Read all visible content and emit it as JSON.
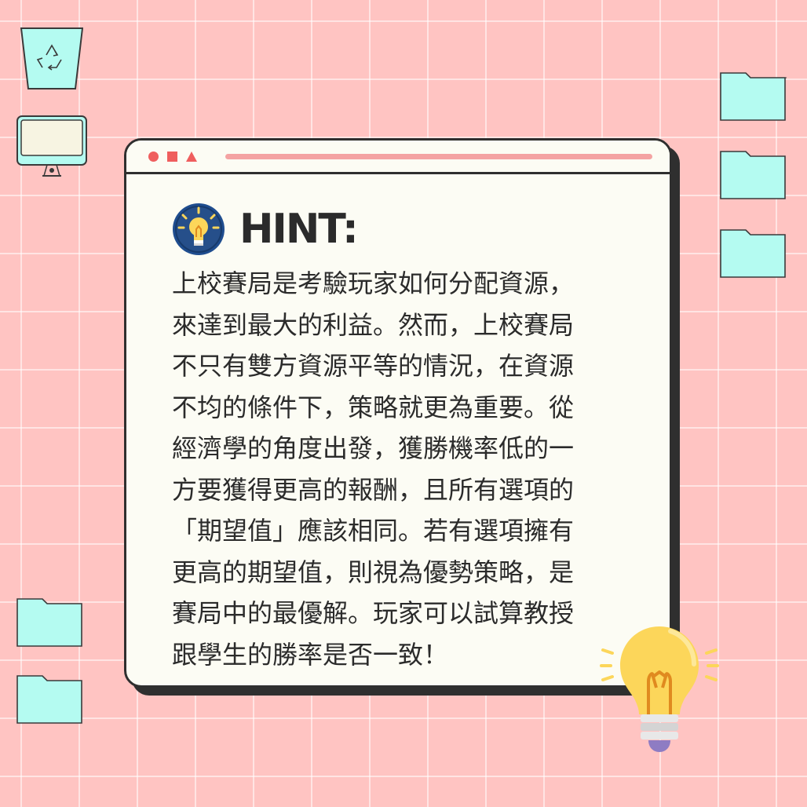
{
  "desktop": {
    "icons": [
      "recycle-bin-icon",
      "computer-icon",
      "folder-icon"
    ]
  },
  "window": {
    "title_controls": [
      "close",
      "minimize",
      "maximize"
    ]
  },
  "hint": {
    "title": "HINT:",
    "lines": [
      "上校賽局是考驗玩家如何分配資源，",
      "來達到最大的利益。然而，上校賽局",
      "不只有雙方資源平等的情況，在資源",
      "不均的條件下，策略就更為重要。從",
      "經濟學的角度出發，獲勝機率低的一",
      "方要獲得更高的報酬，且所有選項的",
      "「期望值」應該相同。若有選項擁有",
      "更高的期望值，則視為優勢策略，是",
      "賽局中的最優解。玩家可以試算教授",
      "跟學生的勝率是否一致！"
    ]
  },
  "colors": {
    "background": "#ffc4c2",
    "folder": "#b4fbf1",
    "window_bg": "#fcfcf4",
    "accent_red": "#ef5e5e",
    "bulb_yellow": "#fcd65a",
    "hint_icon_blue": "#1f4d8f"
  }
}
